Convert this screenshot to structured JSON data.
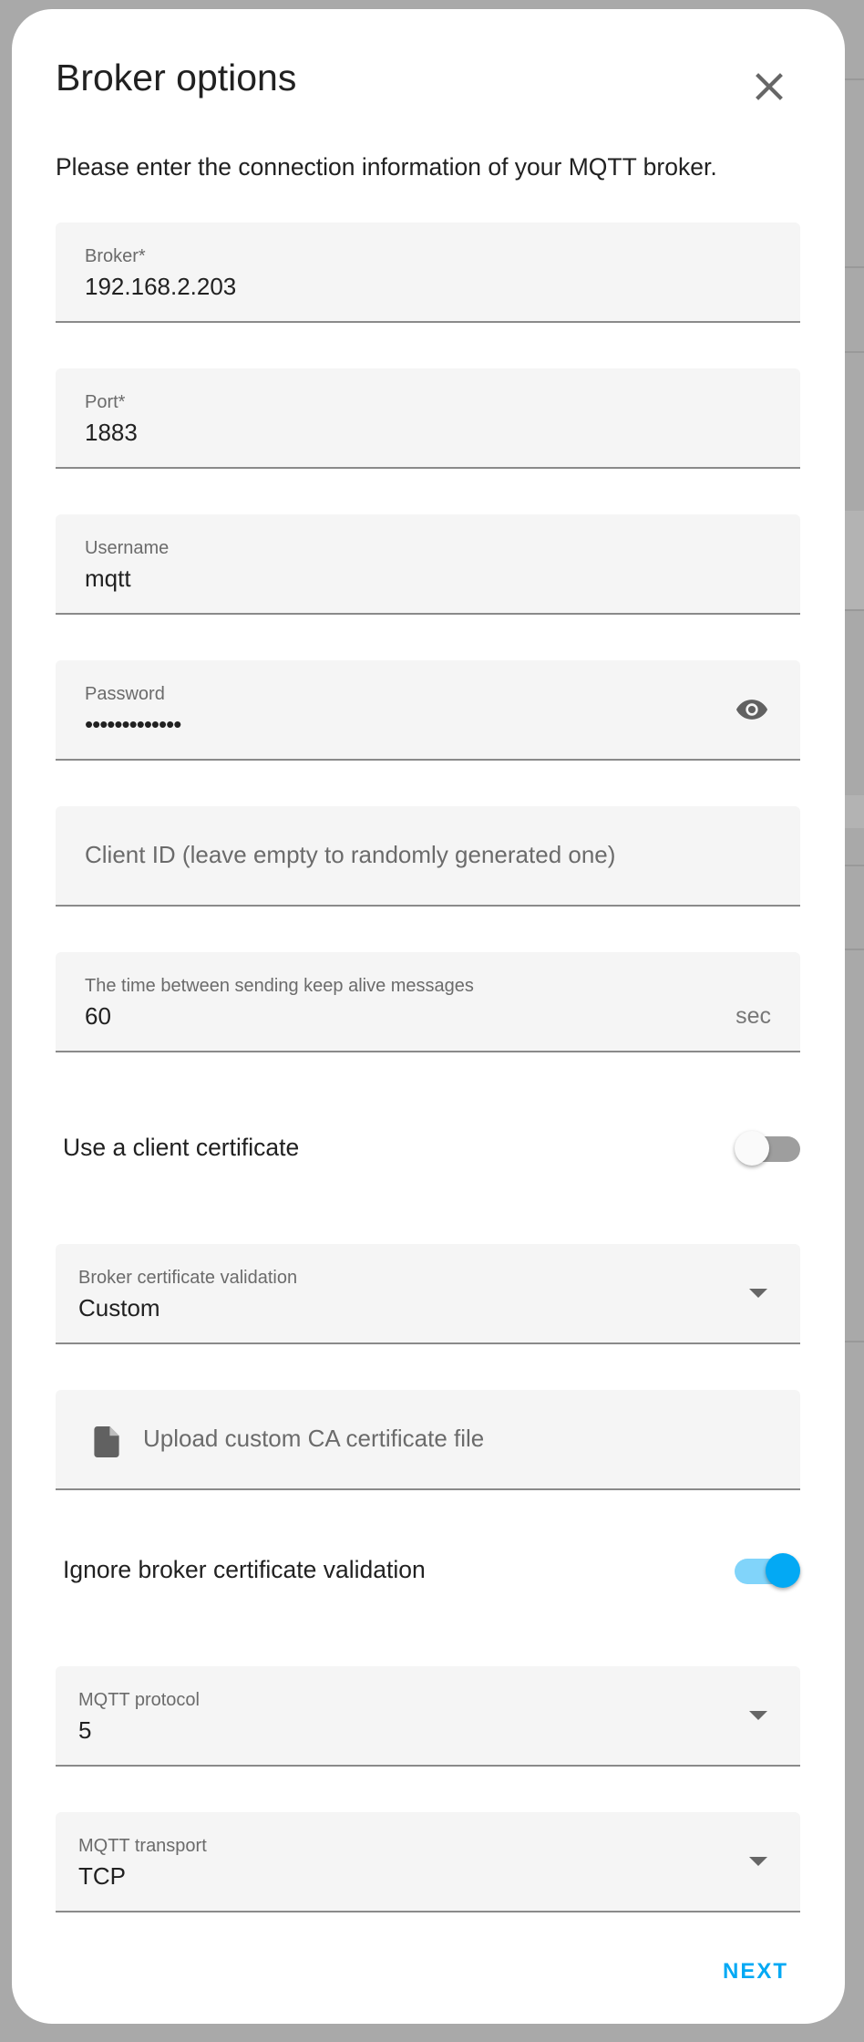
{
  "dialog": {
    "title": "Broker options",
    "description": "Please enter the connection information of your MQTT broker.",
    "close_icon": "close-icon"
  },
  "fields": {
    "broker": {
      "label": "Broker*",
      "value": "192.168.2.203"
    },
    "port": {
      "label": "Port*",
      "value": "1883"
    },
    "username": {
      "label": "Username",
      "value": "mqtt"
    },
    "password": {
      "label": "Password",
      "value": "•••••••••••••",
      "icon": "eye-icon"
    },
    "client_id": {
      "placeholder": "Client ID (leave empty to randomly generated one)"
    },
    "keepalive": {
      "label": "The time between sending keep alive messages",
      "value": "60",
      "suffix": "sec"
    },
    "client_cert": {
      "label": "Use a client certificate",
      "on": false
    },
    "cert_validation": {
      "label": "Broker certificate validation",
      "value": "Custom"
    },
    "upload_ca": {
      "label": "Upload custom CA certificate file",
      "icon": "file-icon"
    },
    "ignore_validation": {
      "label": "Ignore broker certificate validation",
      "on": true
    },
    "protocol": {
      "label": "MQTT protocol",
      "value": "5"
    },
    "transport": {
      "label": "MQTT transport",
      "value": "TCP"
    }
  },
  "actions": {
    "next": "NEXT"
  },
  "colors": {
    "accent": "#03a9f4",
    "accent_track": "#81d4fa",
    "field_bg": "#f5f5f5"
  }
}
